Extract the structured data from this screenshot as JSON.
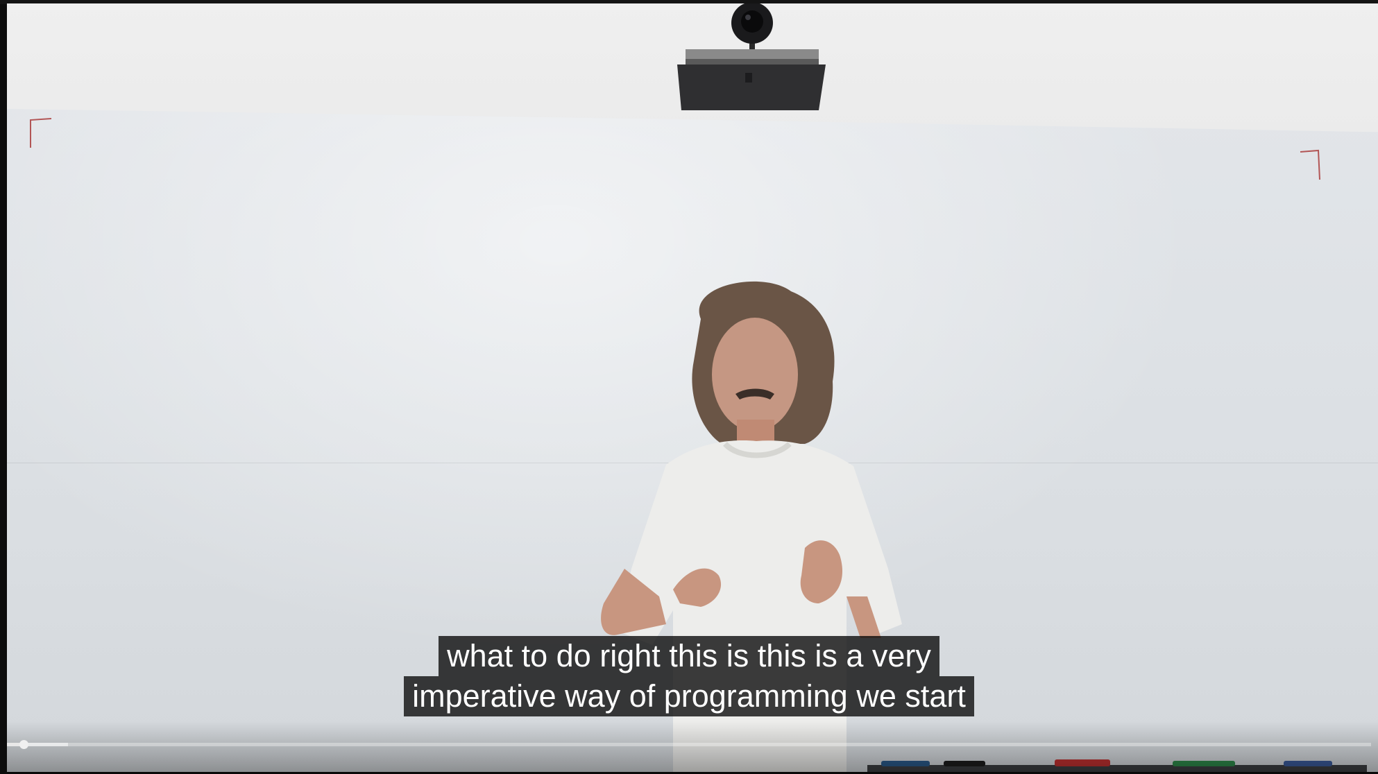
{
  "captions": {
    "line1": "what to do right this is this is a very",
    "line2": "imperative way of programming we start"
  },
  "progress": {
    "played_fraction": 0.012,
    "buffered_fraction": 0.045
  },
  "colors": {
    "caption_bg": "#080808",
    "caption_text": "#ffffff",
    "progress_played": "#e8e8e8",
    "progress_track": "#9a9a9a"
  }
}
